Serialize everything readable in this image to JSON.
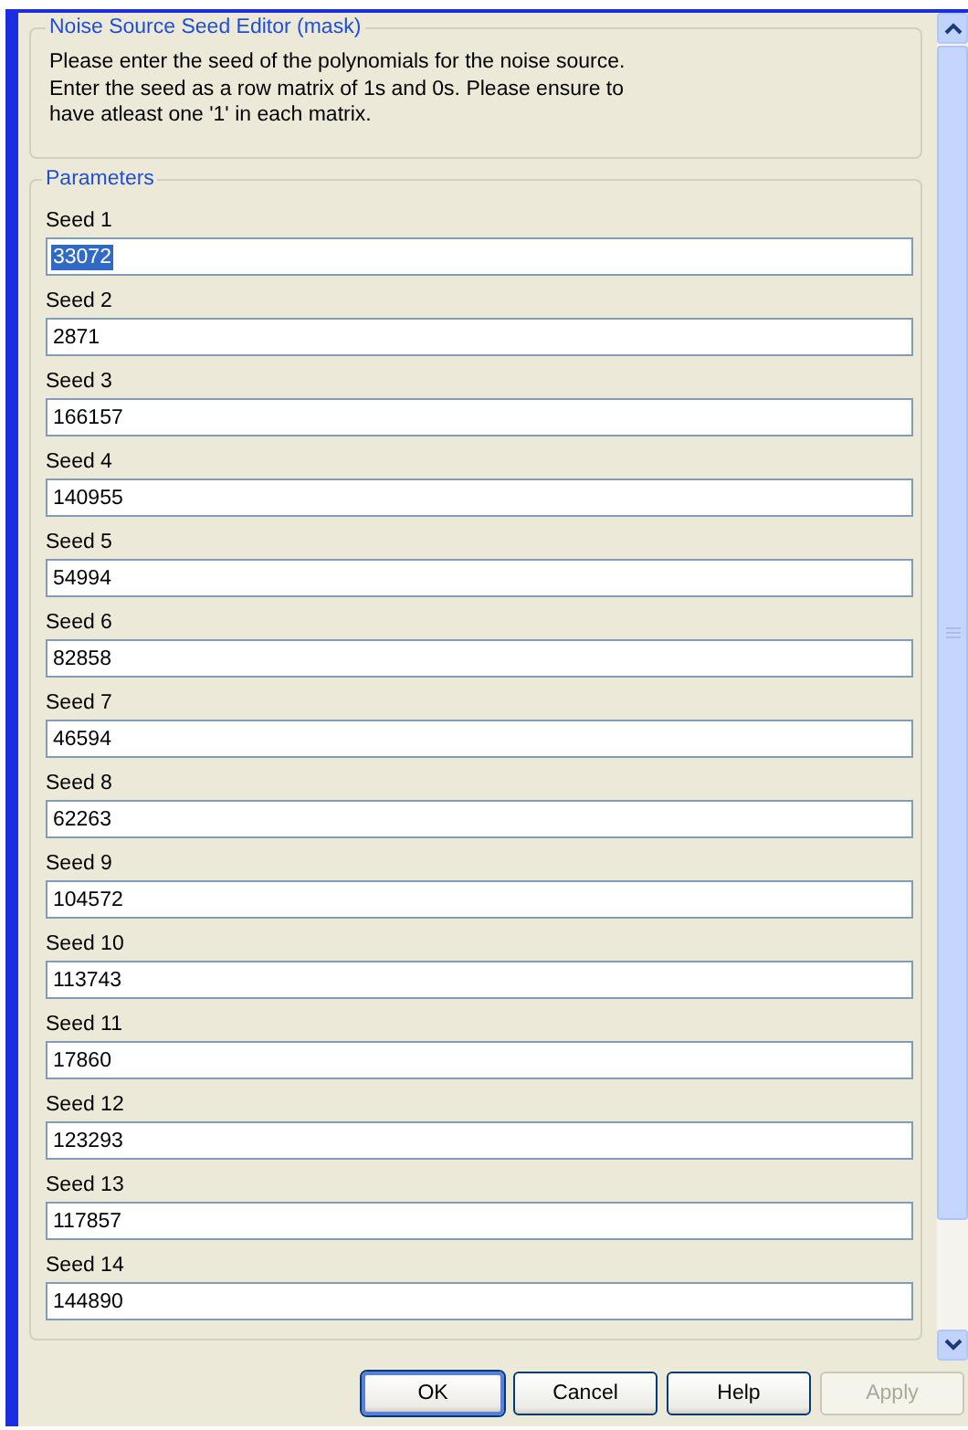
{
  "description_group": {
    "title": "Noise Source Seed Editor (mask)",
    "text": "Please enter the seed of the polynomials for the noise source.\nEnter the seed as a row matrix of 1s and 0s. Please ensure to\nhave atleast one '1' in each matrix."
  },
  "parameters_group": {
    "title": "Parameters",
    "fields": [
      {
        "label": "Seed 1",
        "value": "33072",
        "text_selected": true
      },
      {
        "label": "Seed 2",
        "value": "2871",
        "text_selected": false
      },
      {
        "label": "Seed 3",
        "value": "166157",
        "text_selected": false
      },
      {
        "label": "Seed 4",
        "value": "140955",
        "text_selected": false
      },
      {
        "label": "Seed 5",
        "value": "54994",
        "text_selected": false
      },
      {
        "label": "Seed 6",
        "value": "82858",
        "text_selected": false
      },
      {
        "label": "Seed 7",
        "value": "46594",
        "text_selected": false
      },
      {
        "label": "Seed 8",
        "value": "62263",
        "text_selected": false
      },
      {
        "label": "Seed 9",
        "value": "104572",
        "text_selected": false
      },
      {
        "label": "Seed 10",
        "value": "113743",
        "text_selected": false
      },
      {
        "label": "Seed 11",
        "value": "17860",
        "text_selected": false
      },
      {
        "label": "Seed 12",
        "value": "123293",
        "text_selected": false
      },
      {
        "label": "Seed 13",
        "value": "117857",
        "text_selected": false
      },
      {
        "label": "Seed 14",
        "value": "144890",
        "text_selected": false
      }
    ]
  },
  "buttons": [
    {
      "label": "OK",
      "default": true,
      "disabled": false
    },
    {
      "label": "Cancel",
      "default": false,
      "disabled": false
    },
    {
      "label": "Help",
      "default": false,
      "disabled": false
    },
    {
      "label": "Apply",
      "default": false,
      "disabled": true
    }
  ]
}
